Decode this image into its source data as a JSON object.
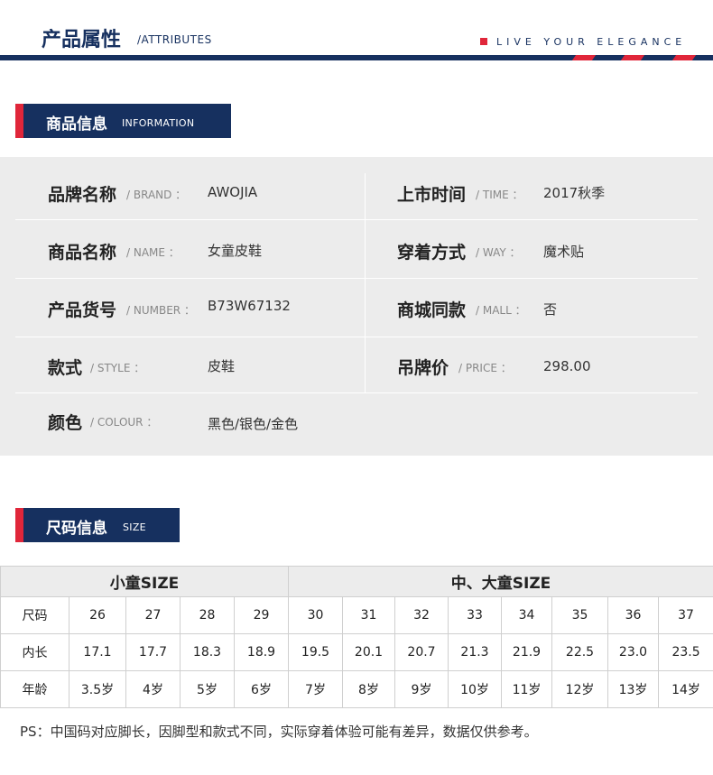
{
  "header": {
    "title": "产品属性",
    "subtitle": "/ATTRIBUTES",
    "tagline": "LIVE YOUR ELEGANCE",
    "colors": {
      "navy": "#16305f",
      "red": "#e0263a",
      "panel": "#ececec"
    }
  },
  "info_section": {
    "title": "商品信息",
    "title_en": "INFORMATION",
    "rows": [
      {
        "left": {
          "label": "品牌名称",
          "en": "/ BRAND ：",
          "value": "AWOJIA"
        },
        "right": {
          "label": "上市时间",
          "en": "/ TIME ：",
          "value": "2017秋季"
        }
      },
      {
        "left": {
          "label": "商品名称",
          "en": "/ NAME ：",
          "value": "女童皮鞋"
        },
        "right": {
          "label": "穿着方式",
          "en": "/ WAY ：",
          "value": "魔术贴"
        }
      },
      {
        "left": {
          "label": "产品货号",
          "en": "/ NUMBER ：",
          "value": "B73W67132"
        },
        "right": {
          "label": "商城同款",
          "en": "/ MALL ：",
          "value": "否"
        }
      },
      {
        "left": {
          "label": "款式",
          "en": "/ STYLE ：",
          "value": "皮鞋"
        },
        "right": {
          "label": "吊牌价",
          "en": "/ PRICE ：",
          "value": "298.00"
        }
      },
      {
        "left": {
          "label": "颜色",
          "en": "/ COLOUR ：",
          "value": "黑色/银色/金色"
        }
      }
    ]
  },
  "size_section": {
    "title": "尺码信息",
    "title_en": "SIZE",
    "groups": [
      "小童SIZE",
      "中、大童SIZE"
    ],
    "rows": [
      {
        "label": "尺码",
        "values": [
          "26",
          "27",
          "28",
          "29",
          "30",
          "31",
          "32",
          "33",
          "34",
          "35",
          "36",
          "37"
        ]
      },
      {
        "label": "内长",
        "values": [
          "17.1",
          "17.7",
          "18.3",
          "18.9",
          "19.5",
          "20.1",
          "20.7",
          "21.3",
          "21.9",
          "22.5",
          "23.0",
          "23.5"
        ]
      },
      {
        "label": "年龄",
        "values": [
          "3.5岁",
          "4岁",
          "5岁",
          "6岁",
          "7岁",
          "8岁",
          "9岁",
          "10岁",
          "11岁",
          "12岁",
          "13岁",
          "14岁"
        ]
      }
    ],
    "note": "PS：中国码对应脚长，因脚型和款式不同，实际穿着体验可能有差异，数据仅供参考。"
  }
}
